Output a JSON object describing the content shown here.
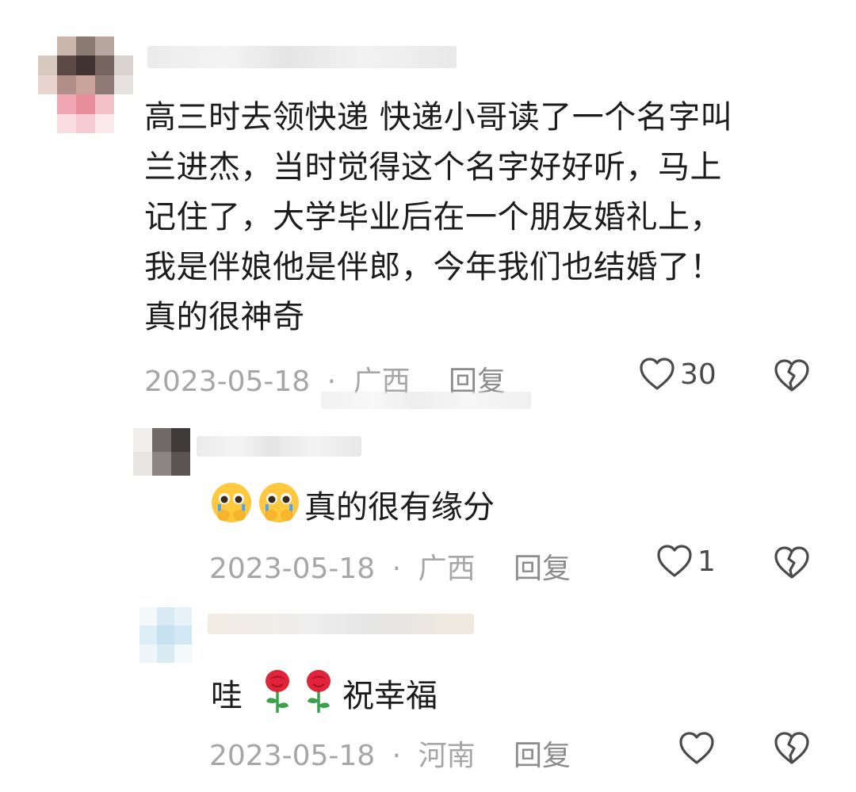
{
  "comments": [
    {
      "text": "高三时去领快递 快递小哥读了一个名字叫\n兰进杰，当时觉得这个名字好好听，马上\n记住了，大学毕业后在一个朋友婚礼上，\n我是伴娘他是伴郎，今年我们也结婚了！\n真的很神奇",
      "date": "2023-05-18",
      "location": "广西",
      "reply_label": "回复",
      "likes": "30",
      "like_icon": "heart-outline-icon",
      "dislike_icon": "broken-heart-icon"
    },
    {
      "emoji": [
        "crying-face-emoji",
        "crying-face-emoji"
      ],
      "text": "真的很有缘分",
      "date": "2023-05-18",
      "location": "广西",
      "reply_label": "回复",
      "likes": "1"
    },
    {
      "prefix": "哇",
      "emoji": [
        "rose-emoji",
        "rose-emoji"
      ],
      "text": "祝幸福",
      "date": "2023-05-18",
      "location": "河南",
      "reply_label": "回复"
    }
  ],
  "separator": "·",
  "colors": {
    "text": "#1c1c1c",
    "meta": "#a6a6a6",
    "icon": "#4a4a4a"
  }
}
